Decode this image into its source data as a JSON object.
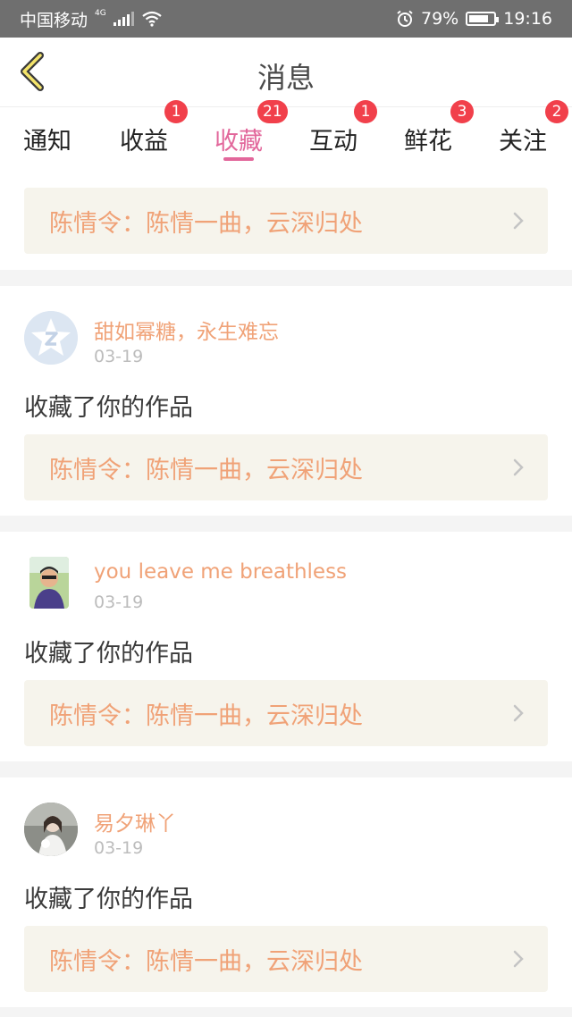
{
  "status_bar": {
    "carrier": "中国移动",
    "network": "4G",
    "battery": "79%",
    "battery_level": 0.79,
    "time": "19:16"
  },
  "header": {
    "title": "消息"
  },
  "tabs": [
    {
      "label": "通知",
      "badge": ""
    },
    {
      "label": "收益",
      "badge": "1"
    },
    {
      "label": "收藏",
      "badge": "21",
      "active": true
    },
    {
      "label": "互动",
      "badge": "1"
    },
    {
      "label": "鲜花",
      "badge": "3"
    },
    {
      "label": "关注",
      "badge": "2"
    }
  ],
  "top_item": {
    "work_title": "陈情令：陈情一曲，云深归处"
  },
  "items": [
    {
      "user": "甜如幂糖，永生难忘",
      "date": "03-19",
      "action": "收藏了你的作品",
      "work_title": "陈情令：陈情一曲，云深归处"
    },
    {
      "user": "you leave me breathless",
      "date": "03-19",
      "action": "收藏了你的作品",
      "work_title": "陈情令：陈情一曲，云深归处"
    },
    {
      "user": "易夕琳丫",
      "date": "03-19",
      "action": "收藏了你的作品",
      "work_title": "陈情令：陈情一曲，云深归处"
    }
  ],
  "colors": {
    "accent": "#e2679b",
    "badge": "#f1404b",
    "link_text": "#f0a277",
    "link_bg": "#f6f4ec"
  }
}
